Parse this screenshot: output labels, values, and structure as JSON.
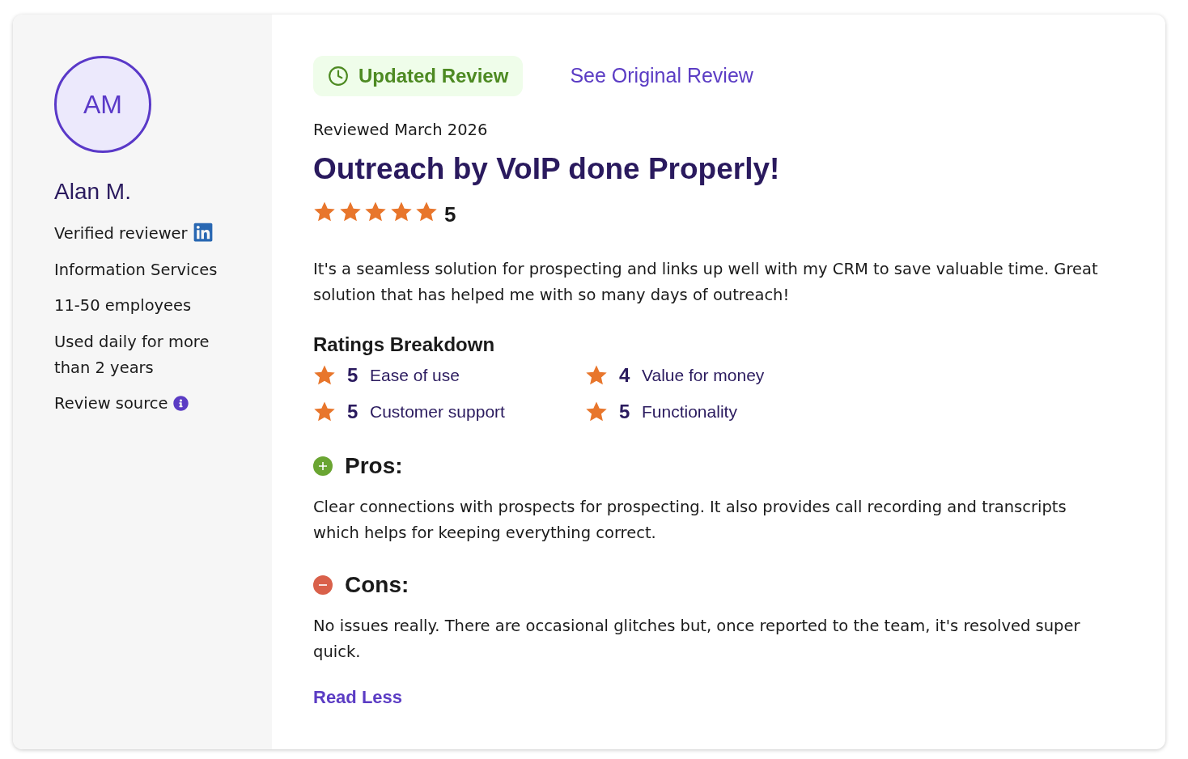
{
  "reviewer": {
    "initials": "AM",
    "name": "Alan M.",
    "details": [
      {
        "kind": "verified",
        "text": "Verified reviewer"
      },
      {
        "kind": "text",
        "text": "Information Services"
      },
      {
        "kind": "text",
        "text": "11-50 employees"
      },
      {
        "kind": "text",
        "text": "Used daily for more than 2 years"
      },
      {
        "kind": "info",
        "text": "Review source"
      }
    ]
  },
  "review": {
    "tabs": [
      {
        "label": "Updated Review",
        "selected": true
      },
      {
        "label": "See Original Review",
        "selected": false
      }
    ],
    "date": "Reviewed March 2026",
    "title": "Outreach by VoIP done Properly!",
    "stars": 5,
    "score": "5",
    "body": "It's a seamless solution for prospecting and links up well with my CRM to save valuable time. Great solution that has helped me with so many days of outreach!",
    "breakdown": {
      "heading": "Ratings Breakdown",
      "items": [
        {
          "score": "5",
          "label": "Ease of use"
        },
        {
          "score": "4",
          "label": "Value for money"
        },
        {
          "score": "5",
          "label": "Customer support"
        },
        {
          "score": "5",
          "label": "Functionality"
        }
      ]
    },
    "sections": [
      {
        "kind": "pros",
        "heading": "Pros:",
        "text": "Clear connections with prospects for prospecting. It also provides call recording and transcripts which helps for keeping everything correct."
      },
      {
        "kind": "cons",
        "heading": "Cons:",
        "text": "No issues really. There are occasional glitches but, once reported to the team, it's resolved super quick."
      }
    ],
    "toggle": "Read Less"
  }
}
